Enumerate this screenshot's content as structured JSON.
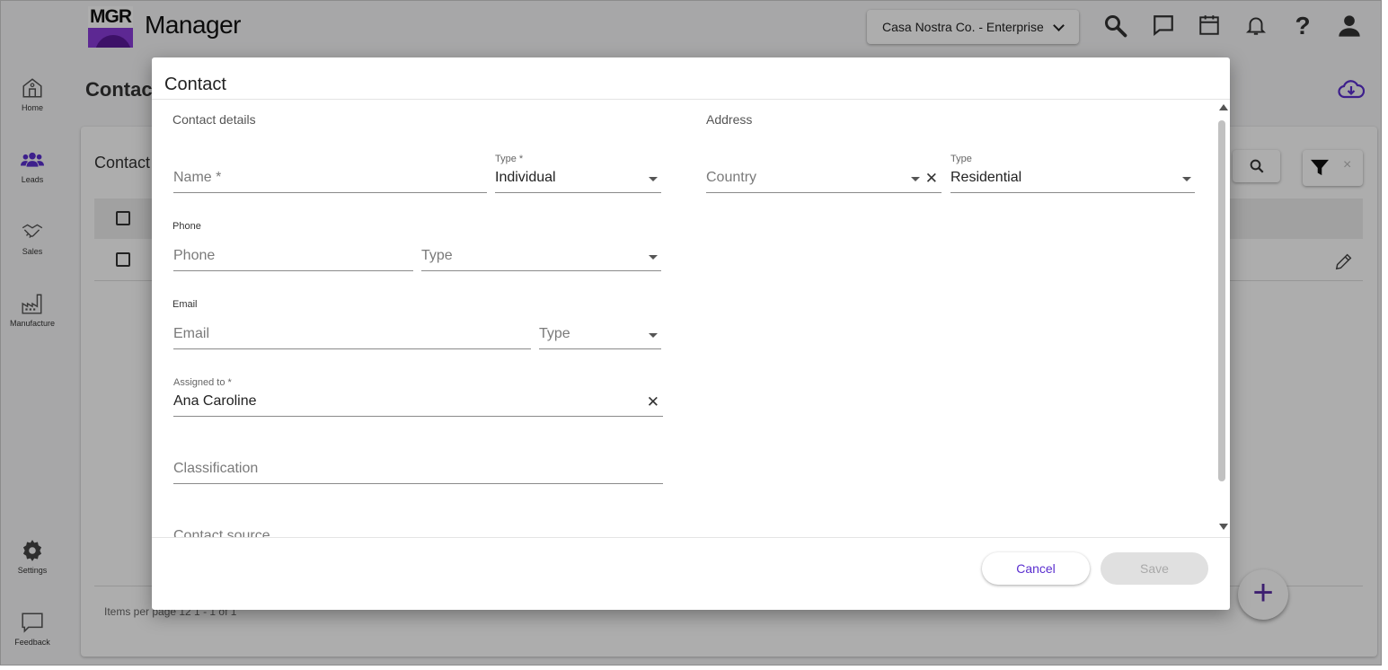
{
  "app": {
    "logo_text": "MGR",
    "title": "Manager",
    "company_selector": "Casa Nostra Co. - Enterprise"
  },
  "topbar_icons": [
    "search-icon",
    "chat-icon",
    "calendar-icon",
    "bell-icon",
    "help-icon",
    "user-icon"
  ],
  "sidebar": {
    "items": [
      {
        "label": "Home",
        "icon": "home-icon"
      },
      {
        "label": "Leads",
        "icon": "people-icon"
      },
      {
        "label": "Sales",
        "icon": "handshake-icon"
      },
      {
        "label": "Manufacture",
        "icon": "factory-icon"
      },
      {
        "label": "Settings",
        "icon": "gear-icon"
      },
      {
        "label": "Feedback",
        "icon": "feedback-icon"
      }
    ]
  },
  "background": {
    "page_title": "Contact",
    "card_title": "Contact",
    "pager_text": "Items per page 12      1 - 1 of 1"
  },
  "modal": {
    "title": "Contact",
    "contact_details": {
      "section_title": "Contact details",
      "name_placeholder": "Name *",
      "type_label": "Type *",
      "type_value": "Individual",
      "phone_group": "Phone",
      "phone_placeholder": "Phone",
      "phone_type_placeholder": "Type",
      "email_group": "Email",
      "email_placeholder": "Email",
      "email_type_placeholder": "Type",
      "assigned_label": "Assigned to *",
      "assigned_value": "Ana Caroline",
      "classification_placeholder": "Classification",
      "contact_source_placeholder": "Contact source"
    },
    "address": {
      "section_title": "Address",
      "country_placeholder": "Country",
      "type_label": "Type",
      "type_value": "Residential"
    },
    "buttons": {
      "cancel": "Cancel",
      "save": "Save"
    }
  },
  "colors": {
    "accent": "#5a2ecf",
    "brand_purple": "#8a3bd9",
    "disabled_bg": "#e0e0e0"
  }
}
